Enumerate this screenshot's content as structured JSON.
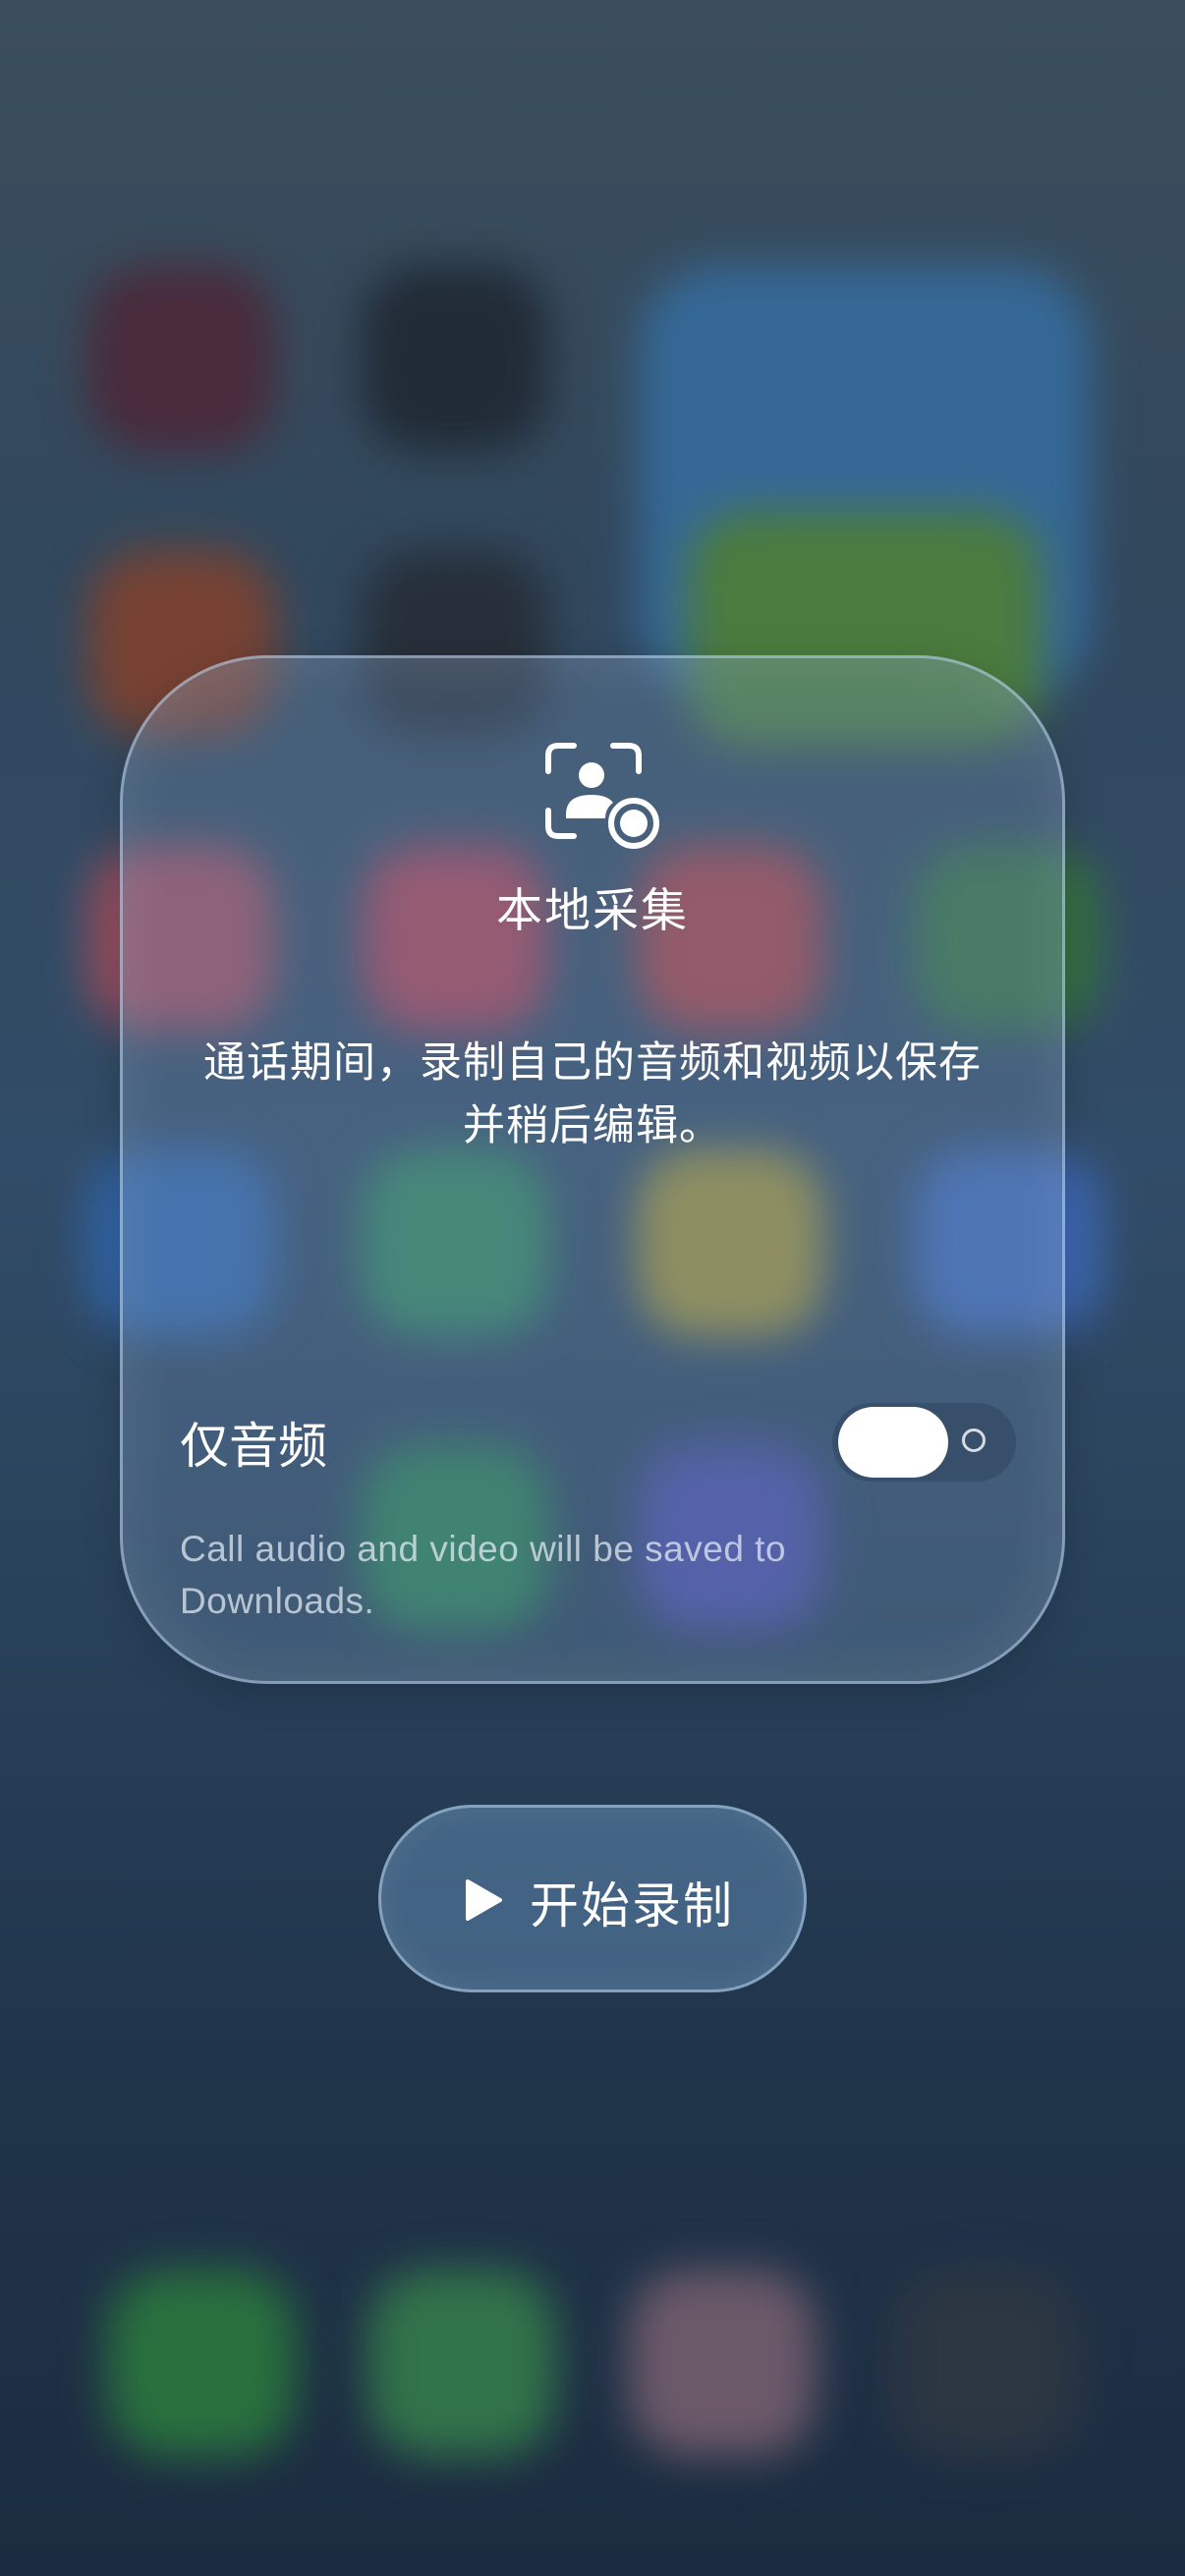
{
  "dialog": {
    "icon": "person-record-icon",
    "title": "本地采集",
    "description": "通话期间，录制自己的音频和视频以保存并稍后编辑。",
    "audio_only_label": "仅音频",
    "audio_only_enabled": true,
    "note": "Call audio and video will be saved to Downloads."
  },
  "actions": {
    "start_label": "开始录制",
    "start_icon": "play-icon"
  },
  "colors": {
    "card_border": "#bed7f0",
    "text": "#ffffff",
    "toggle_knob": "#ffffff"
  }
}
